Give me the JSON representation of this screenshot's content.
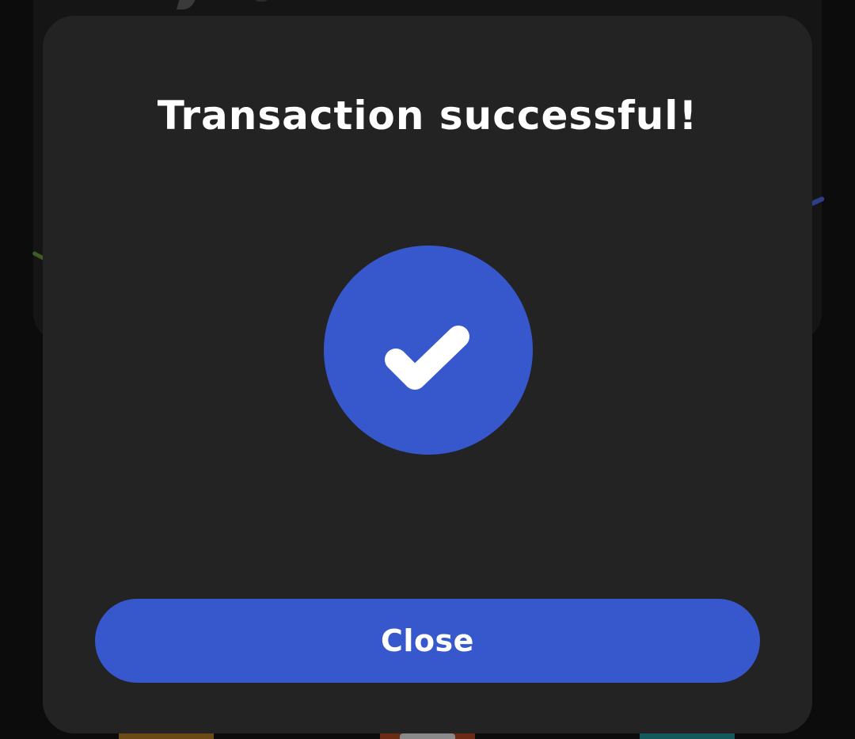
{
  "modal": {
    "title": "Transaction successful!",
    "status_icon": "checkmark-icon",
    "close_label": "Close"
  },
  "colors": {
    "accent": "#3757cc",
    "modal_background": "#232323",
    "backdrop": "#0c0c0c",
    "text": "#ffffff"
  }
}
